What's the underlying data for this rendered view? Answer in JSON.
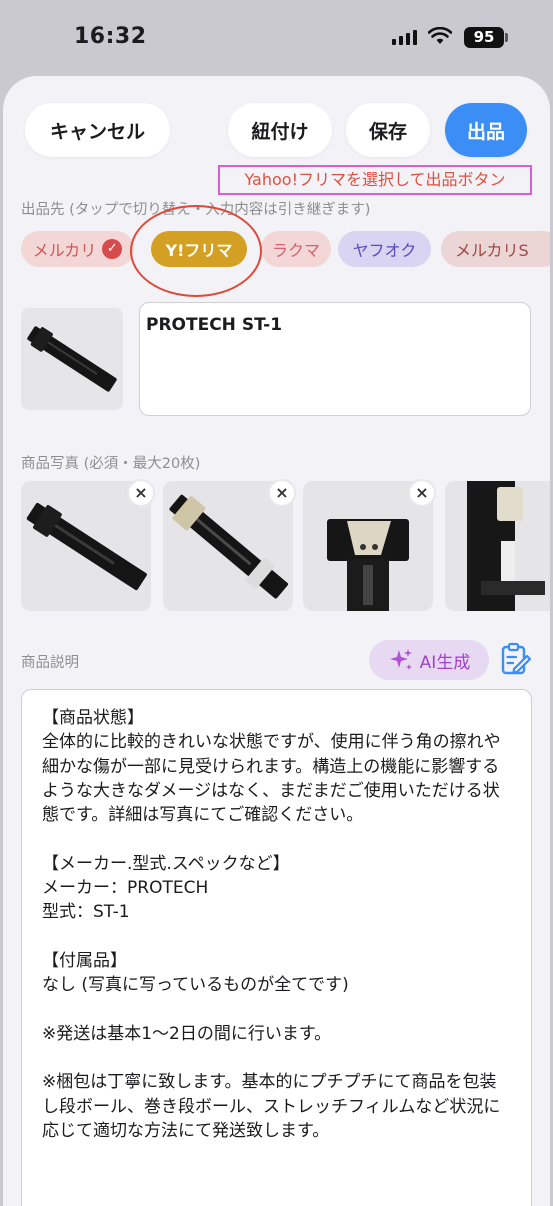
{
  "status": {
    "time": "16:32",
    "battery": "95"
  },
  "toolbar": {
    "cancel": "キャンセル",
    "link": "紐付け",
    "save": "保存",
    "submit": "出品"
  },
  "annotation": "Yahoo!フリマを選択して出品ボタン",
  "destinations": {
    "label": "出品先 (タップで切り替え・入力内容は引き継ぎます)",
    "chips": [
      {
        "label": "メルカリ",
        "checked": true
      },
      {
        "label": "Y!フリマ",
        "selected": true
      },
      {
        "label": "ラクマ"
      },
      {
        "label": "ヤフオク"
      },
      {
        "label": "メルカリS"
      }
    ]
  },
  "title_field": {
    "value": "PROTECH ST-1"
  },
  "photos": {
    "label": "商品写真 (必須・最大20枚)",
    "remove_icon": "×"
  },
  "description": {
    "label": "商品説明",
    "ai_button": "AI生成",
    "text": "【商品状態】\n全体的に比較的きれいな状態ですが、使用に伴う角の擦れや細かな傷が一部に見受けられます。構造上の機能に影響するような大きなダメージはなく、まだまだご使用いただける状態です。詳細は写真にてご確認ください。\n\n【メーカー.型式.スペックなど】\nメーカー：PROTECH\n型式：ST-1\n\n【付属品】\nなし (写真に写っているものが全てです)\n\n※発送は基本1～2日の間に行います。\n\n※梱包は丁寧に致します。基本的にプチプチにて商品を包装し段ボール、巻き段ボール、ストレッチフィルムなど状況に応じて適切な方法にて発送致します。"
  },
  "colors": {
    "accent": "#3a8ef6",
    "yfrima": "#d4a023",
    "annotation": "#e05bd8",
    "highlight_circle": "#dd4a38"
  }
}
